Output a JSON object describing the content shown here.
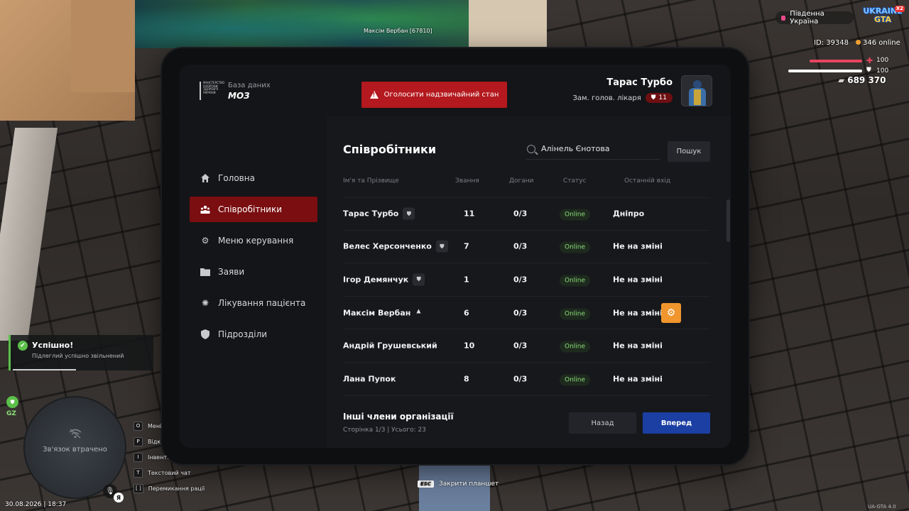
{
  "world": {
    "player_tag": "Максім Вербан [67810]"
  },
  "hud": {
    "server_name": "Південна Україна",
    "logo_line1": "UKRAINE",
    "logo_line2": "GTA",
    "logo_badge": "X2",
    "player_id": "ID: 39348",
    "online": "346 online",
    "health": "100",
    "armor": "100",
    "money": "689 370",
    "datetime": "30.08.2026 | 18:37",
    "version": "UA-GTA 4.0",
    "gz_label": "GZ",
    "minimap_status": "Зв'язок втрачено",
    "lang_badge": "Я"
  },
  "toast": {
    "title": "Успішно!",
    "text": "Підлеглий успішно звільнений",
    "progress": 0.45
  },
  "hints": [
    {
      "key": "O",
      "label": "Мені"
    },
    {
      "key": "P",
      "label": "Відк"
    },
    {
      "key": "I",
      "label": "Інвент."
    },
    {
      "key": "T",
      "label": "Текстовий чат"
    },
    {
      "key": "[  ]",
      "label": "Перемикання рації"
    }
  ],
  "esc_hint": {
    "key": "ESC",
    "label": "Закрити планшет"
  },
  "tablet": {
    "brand": {
      "emblem_text": "МІНІСТЕРСТВО ОХОРОНИ ЗДОРОВ'Я УКРАЇНИ",
      "subtitle": "База даних",
      "title": "МОЗ"
    },
    "emergency_button": "Оголосити надзвичайний стан",
    "user": {
      "name": "Тарас Турбо",
      "role": "Зам. голов. лікаря",
      "rank": "11"
    },
    "nav": [
      {
        "label": "Головна",
        "icon": "home-icon"
      },
      {
        "label": "Співробітники",
        "icon": "users-icon"
      },
      {
        "label": "Меню керування",
        "icon": "gear-icon"
      },
      {
        "label": "Заяви",
        "icon": "folder-icon"
      },
      {
        "label": "Лікування пацієнта",
        "icon": "virus-icon"
      },
      {
        "label": "Підрозділи",
        "icon": "shield-icon"
      }
    ],
    "page_title": "Співробітники",
    "search": {
      "value": "Алінель Єнотова",
      "placeholder": "",
      "button": "Пошук"
    },
    "columns": [
      "Ім'я та Прізвище",
      "Звання",
      "Догани",
      "Статус",
      "Останній вхід"
    ],
    "rows": [
      {
        "name": "Тарас Турбо",
        "shield": true,
        "rank": "11",
        "reprimands": "0/3",
        "status": "Online",
        "last": "Дніпро"
      },
      {
        "name": "Велес Херсонченко",
        "shield": true,
        "rank": "7",
        "reprimands": "0/3",
        "status": "Online",
        "last": "Не на зміні"
      },
      {
        "name": "Ігор Демянчук",
        "shield": true,
        "rank": "1",
        "reprimands": "0/3",
        "status": "Online",
        "last": "Не на зміні"
      },
      {
        "name": "Максім Вербан",
        "shield": false,
        "rank": "6",
        "reprimands": "0/3",
        "status": "Online",
        "last": "Не на зміні"
      },
      {
        "name": "Андрій Грушевський",
        "shield": false,
        "rank": "10",
        "reprimands": "0/3",
        "status": "Online",
        "last": "Не на зміні"
      },
      {
        "name": "Лана Пупок",
        "shield": false,
        "rank": "8",
        "reprimands": "0/3",
        "status": "Online",
        "last": "Не на зміні"
      }
    ],
    "footer": {
      "title": "Інші члени організації",
      "page_info": "Сторінка 1/3 | Усього: 23",
      "back": "Назад",
      "next": "Вперед"
    }
  },
  "colors": {
    "accent_red": "#b3191e",
    "active_nav": "#7a0e10",
    "next_blue": "#1b3fa3",
    "online_green": "#8ce07a",
    "gear_orange": "#f0962d"
  }
}
